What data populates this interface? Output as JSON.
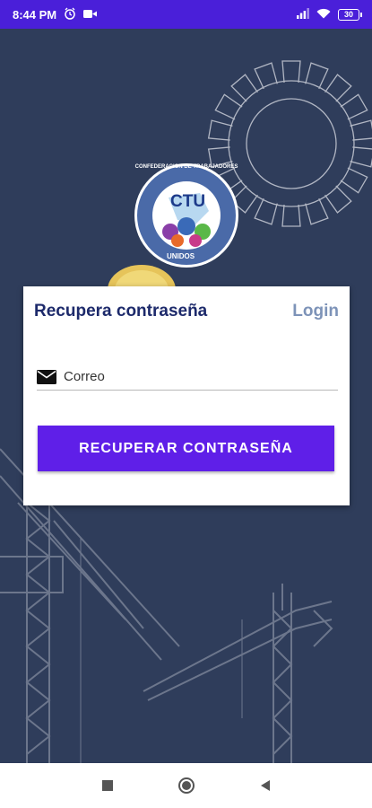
{
  "status_bar": {
    "time": "8:44 PM",
    "battery": "30",
    "icons": [
      "alarm-icon",
      "video-icon",
      "signal-icon",
      "wifi-icon",
      "battery-icon"
    ]
  },
  "logo": {
    "ring_text": "CONFEDERACION DE TRABAJADORES",
    "center_text": "CTU",
    "bottom_text": "UNIDOS"
  },
  "card": {
    "title": "Recupera contraseña",
    "login_link": "Login",
    "email_placeholder": "Correo",
    "button_label": "RECUPERAR CONTRASEÑA"
  },
  "nav_bar": {
    "icons": [
      "recents-icon",
      "home-icon",
      "back-icon"
    ]
  },
  "colors": {
    "status_bar": "#4a1fd9",
    "background": "#2f3d5b",
    "primary_button": "#5f1fe8",
    "title": "#1d2a6b",
    "link": "#7d93b8"
  }
}
